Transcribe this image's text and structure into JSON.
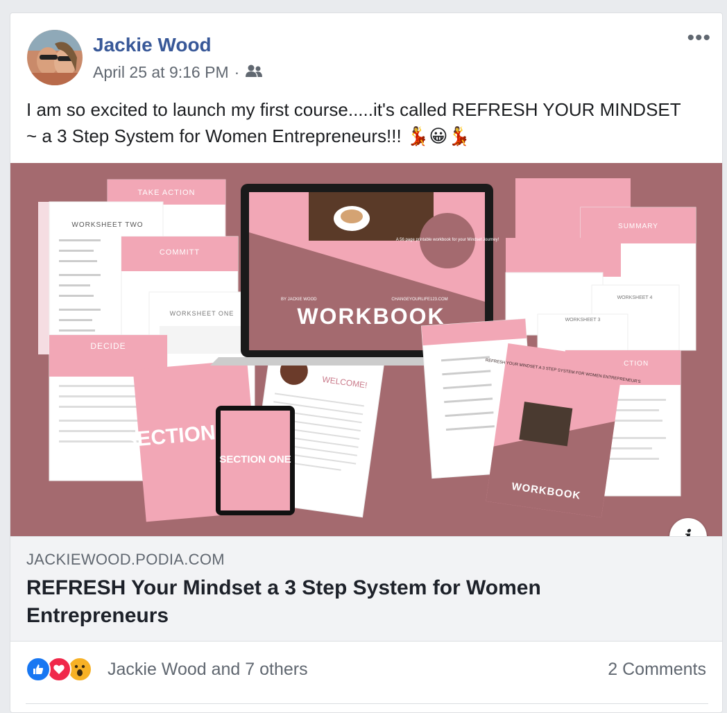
{
  "post": {
    "author": "Jackie Wood",
    "timestamp": "April 25 at 9:16 PM",
    "separator": "·",
    "audience_icon": "friends-icon",
    "more_label": "•••",
    "text": "I am so excited to launch my first course.....it's called REFRESH YOUR MINDSET ~ a 3 Step System for Women Entrepreneurs!!!",
    "emojis": [
      "💃",
      "😀",
      "💃"
    ]
  },
  "image": {
    "workbook_title": "WORKBOOK",
    "by_line": "BY JACKIE WOOD",
    "site_small": "CHANGEYOURLIFE123.COM",
    "bubble_text": "A 56 page printable workbook for your Mindset Journey!",
    "section_one": "SECTION ONE",
    "section_two": "SECTION TWO",
    "take_action": "TAKE ACTION",
    "commit": "COMMITT",
    "decide": "DECIDE",
    "summary": "SUMMARY",
    "worksheet_two": "WORKSHEET TWO",
    "worksheet_one": "WORKSHEET ONE",
    "worksheet_four": "WORKSHEET 4",
    "worksheet_three": "WORKSHEET 3",
    "welcome": "WELCOME!",
    "refresh_cover": "REFRESH YOUR MINDSET A 3 STEP SYSTEM FOR WOMEN ENTREPRENEUR'S",
    "workbook_small": "WORKBOOK",
    "info_label": "i"
  },
  "link": {
    "domain": "JACKIEWOOD.PODIA.COM",
    "title": "REFRESH Your Mindset a 3 Step System for Women Entrepreneurs"
  },
  "footer": {
    "reactions_text": "Jackie Wood and 7 others",
    "comments": "2 Comments"
  },
  "colors": {
    "name": "#385898",
    "hero_bg": "#a46a6f",
    "pink": "#f2a7b6",
    "like": "#1877f2",
    "love": "#f0284a",
    "wow": "#f7b125"
  }
}
